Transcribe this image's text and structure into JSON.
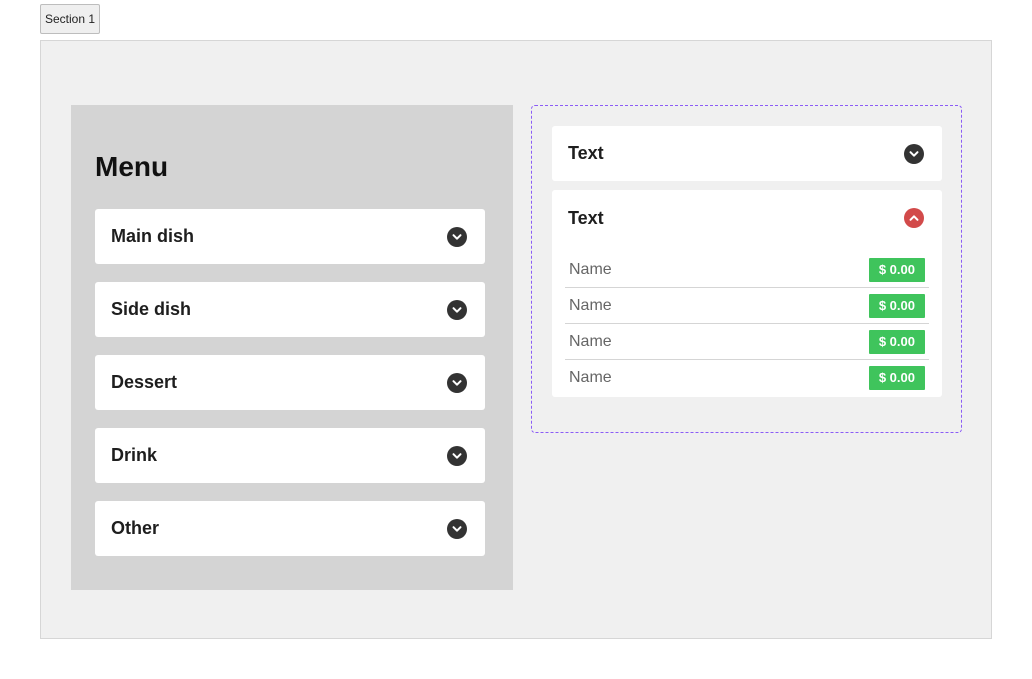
{
  "section_tab": {
    "label": "Section 1"
  },
  "menu": {
    "title": "Menu",
    "items": [
      {
        "label": "Main dish"
      },
      {
        "label": "Side dish"
      },
      {
        "label": "Dessert"
      },
      {
        "label": "Drink"
      },
      {
        "label": "Other"
      }
    ]
  },
  "right_accordion": {
    "items": [
      {
        "label": "Text",
        "expanded": false
      },
      {
        "label": "Text",
        "expanded": true,
        "rows": [
          {
            "name": "Name",
            "price": "$ 0.00"
          },
          {
            "name": "Name",
            "price": "$ 0.00"
          },
          {
            "name": "Name",
            "price": "$ 0.00"
          },
          {
            "name": "Name",
            "price": "$ 0.00"
          }
        ]
      }
    ]
  },
  "colors": {
    "section_bg": "#f0f0f0",
    "menu_panel_bg": "#d4d4d4",
    "chevron_closed": "#333333",
    "chevron_open": "#d24a4a",
    "price_badge": "#3fc45c",
    "selection_outline": "#8b5cf6"
  },
  "icons": {
    "collapsed": "chevron-down-icon",
    "expanded": "chevron-up-icon"
  }
}
